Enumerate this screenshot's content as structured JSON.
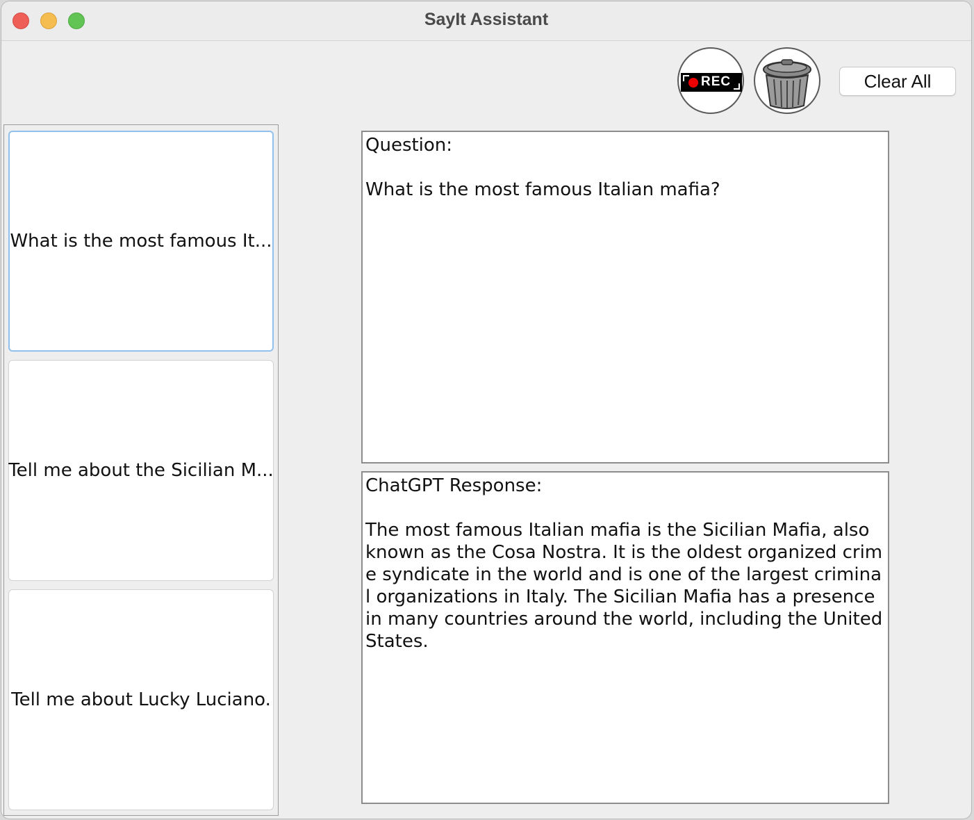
{
  "window": {
    "title": "SayIt Assistant"
  },
  "toolbar": {
    "record_label": "REC",
    "record_icon": "rec-icon",
    "delete_icon": "trash-can-icon",
    "clear_all_label": "Clear All"
  },
  "history": {
    "items": [
      {
        "label": "What is the most famous It...",
        "selected": true
      },
      {
        "label": "Tell me about the Sicilian M...",
        "selected": false
      },
      {
        "label": "Tell me about Lucky Luciano.",
        "selected": false
      }
    ]
  },
  "question_panel": {
    "text": "Question:\n\nWhat is the most famous Italian mafia?"
  },
  "response_panel": {
    "text": "ChatGPT Response:\n\nThe most famous Italian mafia is the Sicilian Mafia, also known as the Cosa Nostra. It is the oldest organized crime syndicate in the world and is one of the largest criminal organizations in Italy. The Sicilian Mafia has a presence in many countries around the world, including the United States."
  },
  "colors": {
    "selected_border": "#92c0ec",
    "close": "#ee5f57",
    "minimize": "#f5bd4f",
    "zoom": "#61c454"
  }
}
